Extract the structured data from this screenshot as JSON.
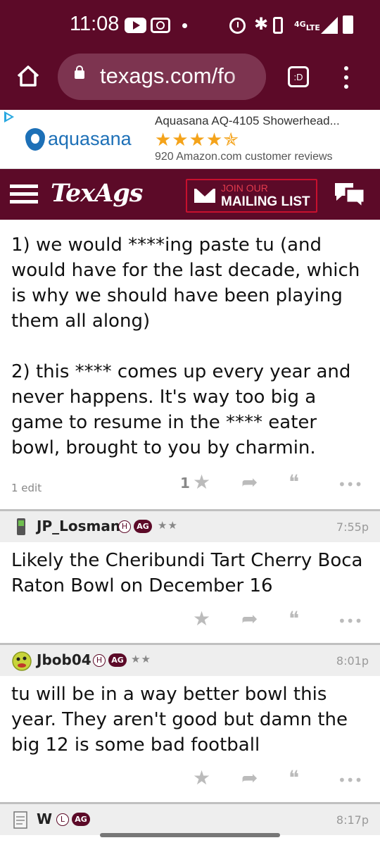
{
  "status_bar": {
    "time": "11:08",
    "network": "4G"
  },
  "browser": {
    "url": "texags.com/fo",
    "tab_badge": ":D"
  },
  "ad": {
    "brand": "aquasana",
    "title": "Aquasana AQ-4105 Showerhead...",
    "rating_stars": "★★★★✯",
    "reviews": "920 Amazon.com customer reviews"
  },
  "header": {
    "brand": "TexAgs",
    "mailing_top": "JOIN OUR",
    "mailing_bottom": "MAILING LIST"
  },
  "first_post": {
    "paragraph1": "1) we would ****ing paste tu (and would have for the last decade, which is why we should have been playing them all along)",
    "paragraph2": "2) this **** comes up every year and never happens. It's way too big a game to resume in the **** eater bowl, brought to you by charmin.",
    "edit_note": "1 edit",
    "like_count": "1"
  },
  "posts": [
    {
      "username": "JP_Losman",
      "badge_h": "H",
      "badge_ag": "AG",
      "rank": "★★",
      "time": "7:55p",
      "body": "Likely the Cheribundi Tart Cherry Boca Raton Bowl on December 16"
    },
    {
      "username": "Jbob04",
      "badge_h": "H",
      "badge_ag": "AG",
      "rank": "★★",
      "time": "8:01p",
      "body": "tu will be in a way better bowl this year. They aren't good but damn the big 12 is some bad football"
    },
    {
      "username": "W",
      "badge_h": "L",
      "badge_ag": "AG",
      "time": "8:17p"
    }
  ],
  "icons": {
    "star": "★",
    "reply": "➦",
    "quote": "❝",
    "more": "•••"
  },
  "colors": {
    "brand_maroon": "#5c0a28",
    "ad_blue": "#1d70b7",
    "star_gold": "#f4a31a"
  }
}
